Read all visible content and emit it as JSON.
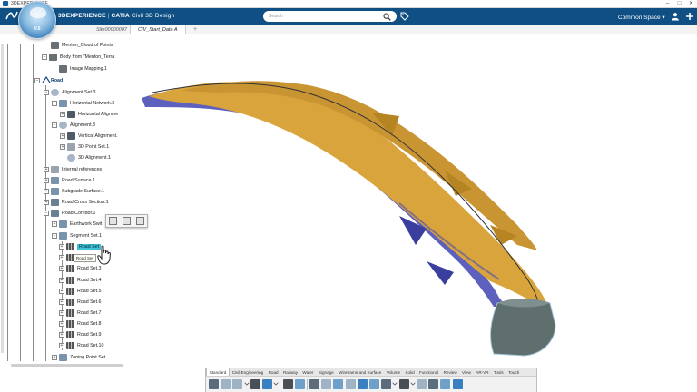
{
  "os_bar": {
    "app_name": "3DEXPERIENCE",
    "controls": [
      "–",
      "□",
      "✕"
    ]
  },
  "header": {
    "compass_version": "V.6",
    "brand_3d": "3D",
    "brand_experience": "EXPERIENCE",
    "brand_sep": "|",
    "brand_catia": "CATIA",
    "brand_app": "Civil 3D Design",
    "search_placeholder": "Search",
    "space_label": "Common Space",
    "space_arrow": "▾"
  },
  "tabs": [
    {
      "label": "Site00000007",
      "active": false
    },
    {
      "label": "CIV_Start_Data A",
      "active": true
    }
  ],
  "tab_add": "+",
  "tree": {
    "items": [
      {
        "label": "Menton_Cloud of Points",
        "icon": "points-icon"
      },
      {
        "label": "Body from \"Menton_Terra",
        "icon": "body-icon"
      },
      {
        "label": "Image Mapping.1",
        "icon": "image-icon"
      },
      {
        "label": "Road",
        "icon": "road-icon"
      },
      {
        "label": "Alignment Set.3",
        "icon": "alignment-icon"
      },
      {
        "label": "Horizontal Network.3",
        "icon": "network-icon"
      },
      {
        "label": "Horizontal Alignme",
        "icon": "curve-icon"
      },
      {
        "label": "Alignment.3",
        "icon": "alignment-icon"
      },
      {
        "label": "Vertical Alignment.",
        "icon": "curve-icon"
      },
      {
        "label": "3D Point Set.1",
        "icon": "point-set-icon"
      },
      {
        "label": "3D Alignment.1",
        "icon": "alignment-icon"
      },
      {
        "label": "Internal references",
        "icon": "reference-icon"
      },
      {
        "label": "Road Surface.1",
        "icon": "surface-icon"
      },
      {
        "label": "Subgrade Surface.1",
        "icon": "surface-icon"
      },
      {
        "label": "Road Cross Section.1",
        "icon": "section-icon"
      },
      {
        "label": "Road Corridor.1",
        "icon": "corridor-icon"
      },
      {
        "label": "Earthwork Swit",
        "icon": "earthwork-icon"
      },
      {
        "label": "Segment Set.1",
        "icon": "segment-icon"
      },
      {
        "label": "Road Set.1",
        "icon": "road-set-icon"
      },
      {
        "label": "Road Set.2",
        "icon": "road-set-icon"
      },
      {
        "label": "Road Set.3",
        "icon": "road-set-icon"
      },
      {
        "label": "Road Set.4",
        "icon": "road-set-icon"
      },
      {
        "label": "Road Set.5",
        "icon": "road-set-icon"
      },
      {
        "label": "Road Set.6",
        "icon": "road-set-icon"
      },
      {
        "label": "Road Set.7",
        "icon": "road-set-icon"
      },
      {
        "label": "Road Set.8",
        "icon": "road-set-icon"
      },
      {
        "label": "Road Set.9",
        "icon": "road-set-icon"
      },
      {
        "label": "Road Set.10",
        "icon": "road-set-icon"
      },
      {
        "label": "Zoning Point Set",
        "icon": "zoning-icon"
      }
    ],
    "selected_label": "Road Set",
    "tooltip": "Road Set"
  },
  "action_bar": {
    "tabs": [
      "Standard",
      "Civil Engineering",
      "Road",
      "Railway",
      "Water",
      "Signage",
      "Wireframe and Surface",
      "Volume",
      "Solid",
      "Functional",
      "Review",
      "View",
      "AR-VR",
      "Tools",
      "Touch"
    ],
    "active_tab": "Standard"
  },
  "colors": {
    "header": "#0f4f84",
    "road_surface": "#d9a43c",
    "terrain_cut": "#4b4fb5",
    "end_section": "#5f6f6d",
    "selection": "#3fc1d7"
  }
}
